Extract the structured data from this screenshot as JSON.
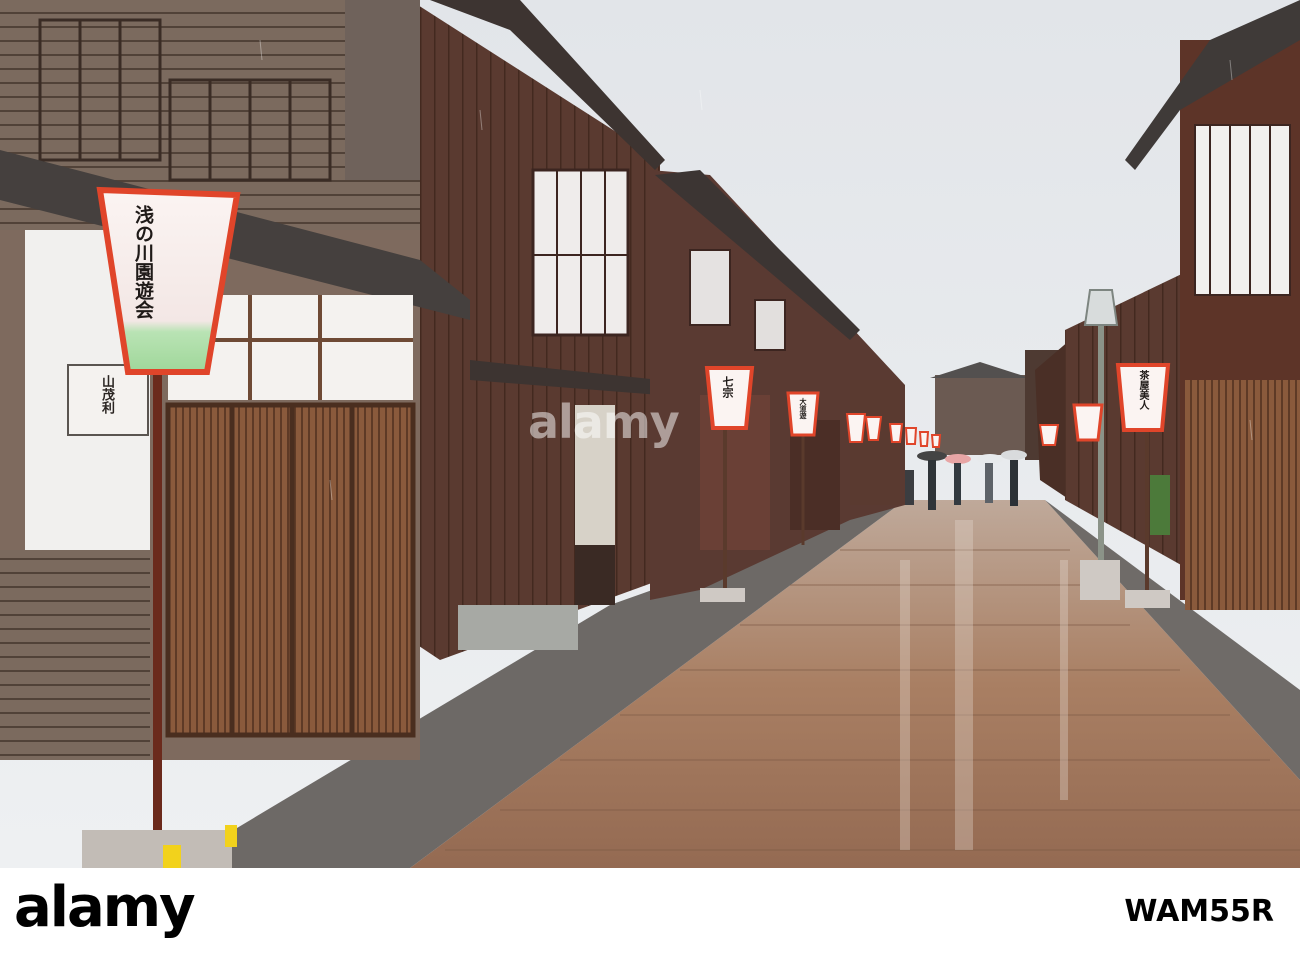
{
  "scene": {
    "subject": "higashi-chaya-street",
    "sky_color": "#e6e8eb",
    "wood_color": "#5b3a30",
    "pavement_color": "#a57d62",
    "lantern_frame_color": "#e0452a"
  },
  "lanterns": {
    "left_near": "浅の川園遊会",
    "left_mid": "七宗",
    "left_far": "大道遊",
    "right_near": "茶屋美人"
  },
  "signs": {
    "shop_sign": "山茂利"
  },
  "watermark": {
    "text": "alamy"
  },
  "footer": {
    "logo": "alamy",
    "image_id": "WAM55R"
  }
}
